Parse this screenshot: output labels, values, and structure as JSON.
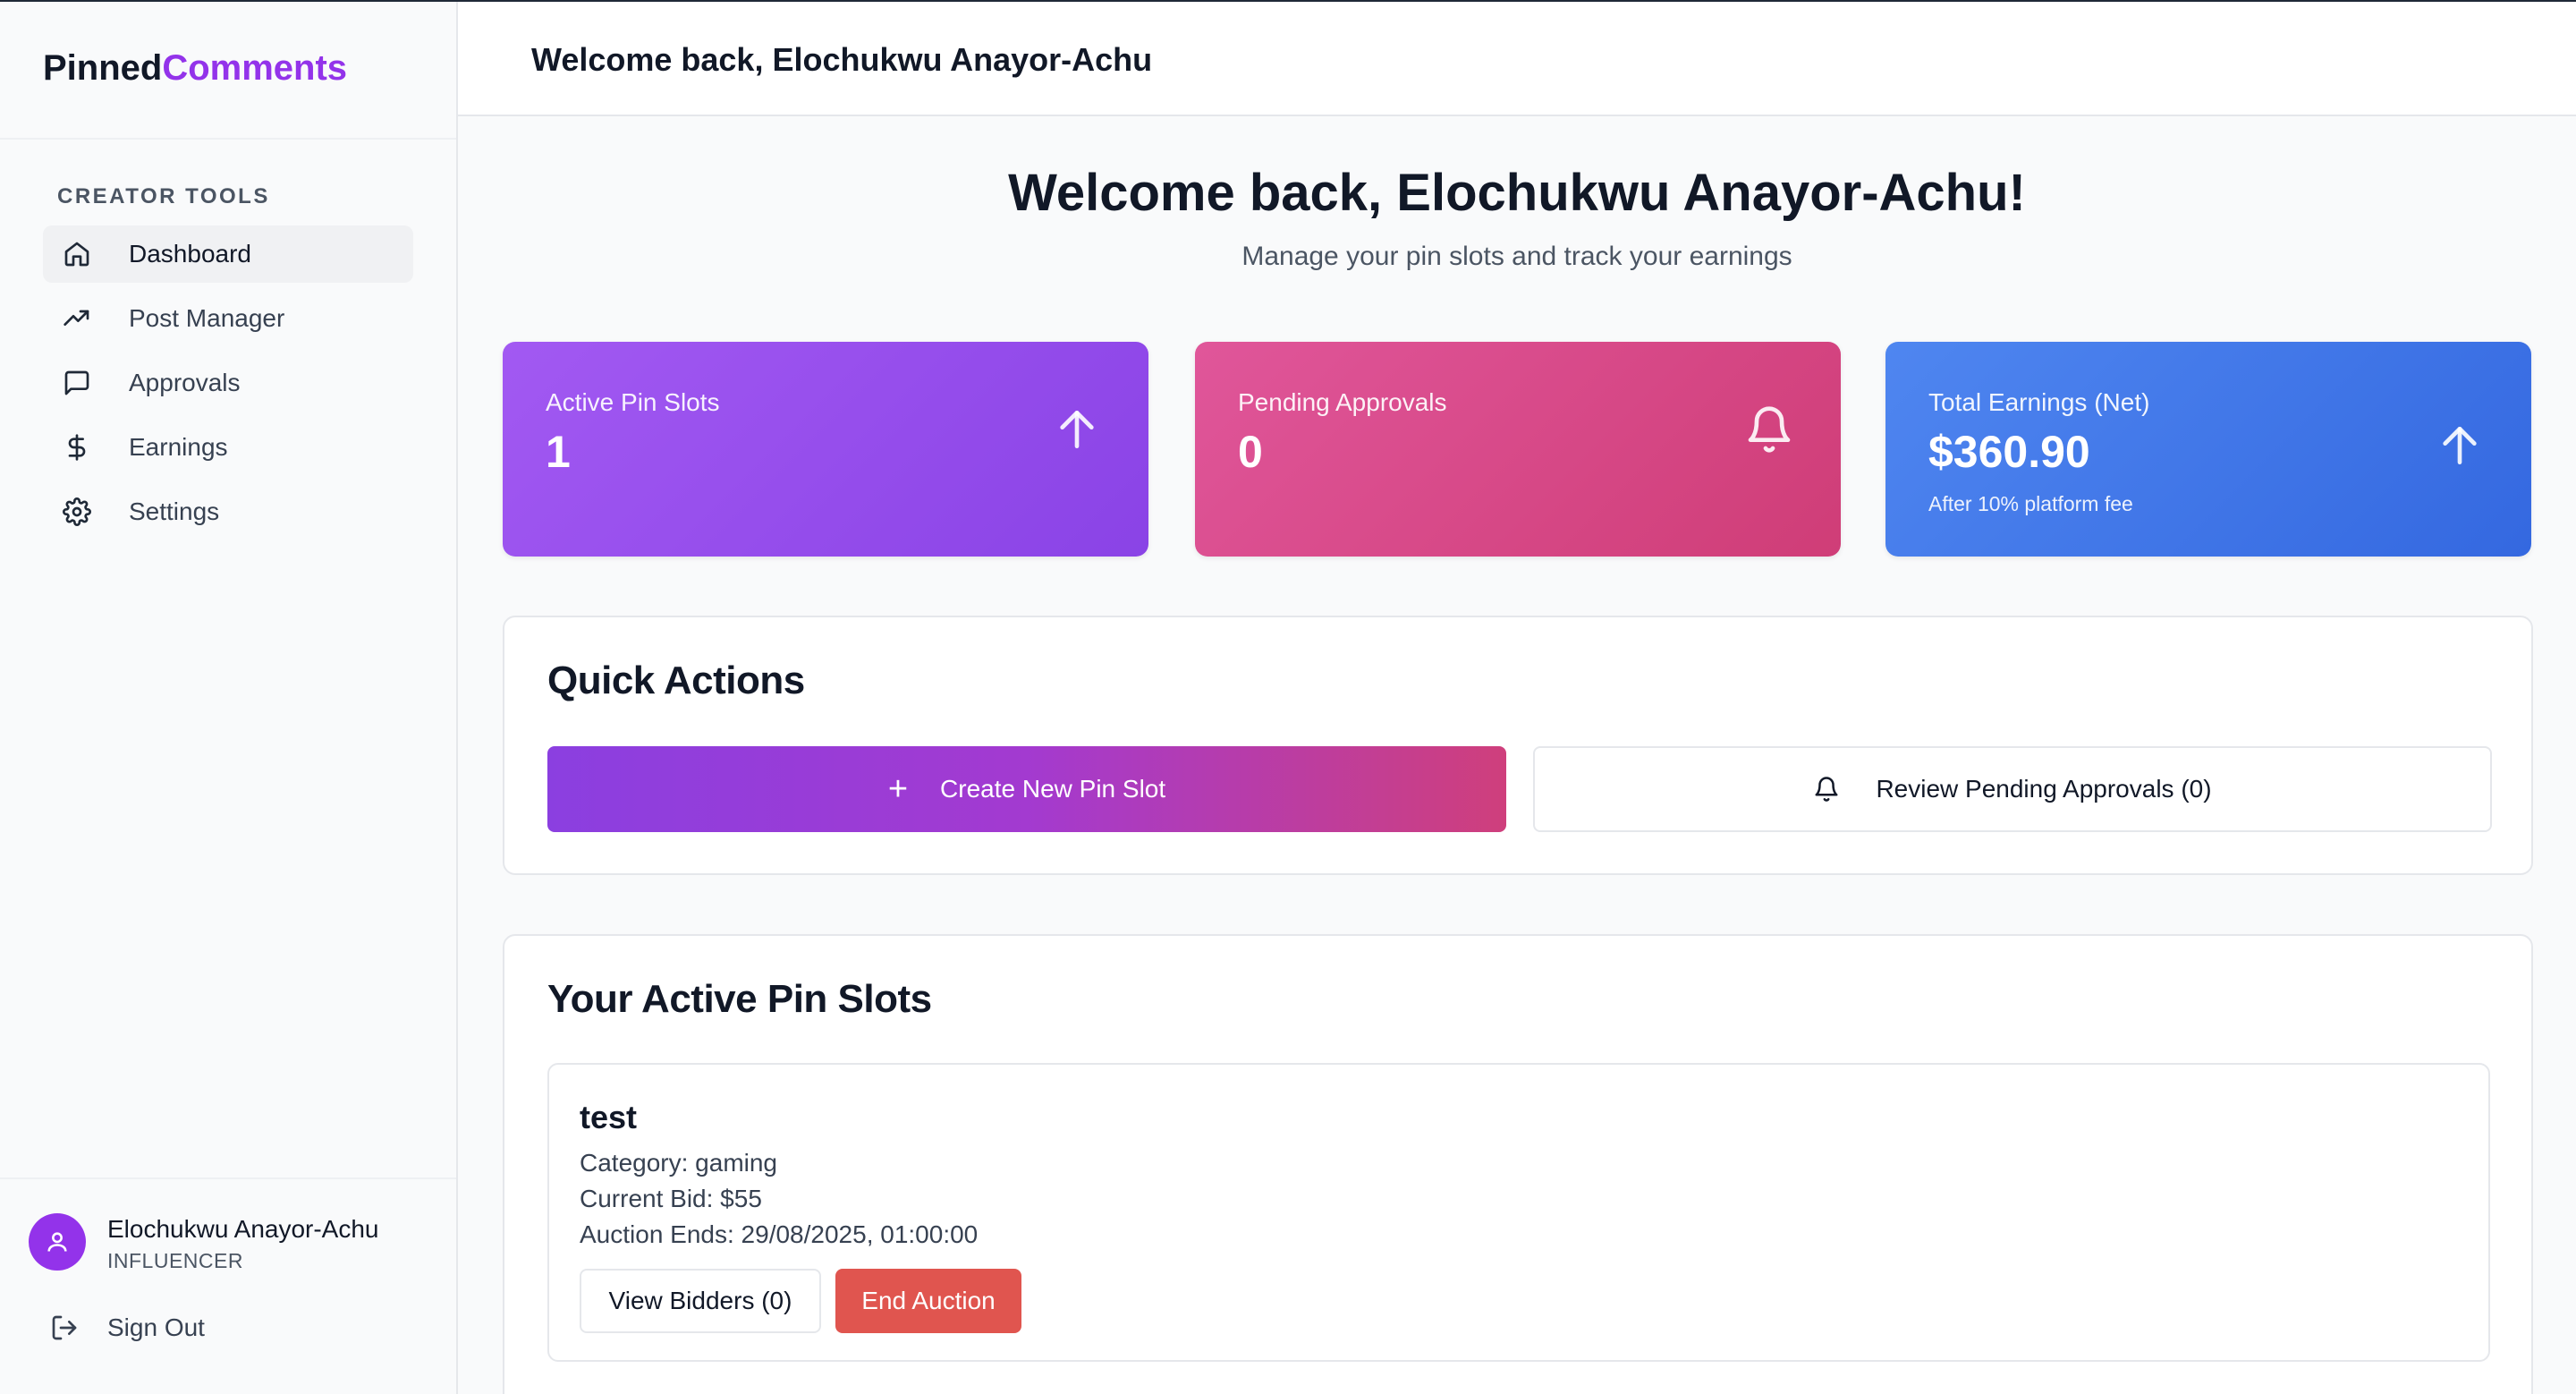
{
  "brand": {
    "part1": "Pinned",
    "part2": "Comments"
  },
  "sidebar": {
    "section_label": "CREATOR TOOLS",
    "items": [
      {
        "label": "Dashboard",
        "icon": "home-icon",
        "active": true
      },
      {
        "label": "Post Manager",
        "icon": "trending-up-icon"
      },
      {
        "label": "Approvals",
        "icon": "message-square-icon"
      },
      {
        "label": "Earnings",
        "icon": "dollar-icon"
      },
      {
        "label": "Settings",
        "icon": "gear-icon"
      }
    ],
    "user": {
      "name": "Elochukwu Anayor-Achu",
      "role": "INFLUENCER"
    },
    "signout_label": "Sign Out"
  },
  "header": {
    "title": "Welcome back, Elochukwu Anayor-Achu"
  },
  "hero": {
    "title": "Welcome back, Elochukwu Anayor-Achu!",
    "subtitle": "Manage your pin slots and track your earnings"
  },
  "stats": [
    {
      "label": "Active Pin Slots",
      "value": "1",
      "icon": "arrow-up-icon",
      "color": "#9b51ef"
    },
    {
      "label": "Pending Approvals",
      "value": "0",
      "icon": "bell-icon",
      "color": "#d84a88"
    },
    {
      "label": "Total Earnings (Net)",
      "value": "$360.90",
      "note": "After 10% platform fee",
      "icon": "arrow-up-icon",
      "color": "#4178e8"
    }
  ],
  "quick_actions": {
    "title": "Quick Actions",
    "create_label": "Create New Pin Slot",
    "review_label": "Review Pending Approvals (0)"
  },
  "active_slots": {
    "title": "Your Active Pin Slots",
    "items": [
      {
        "name": "test",
        "category": "Category: gaming",
        "current_bid": "Current Bid: $55",
        "auction_ends": "Auction Ends: 29/08/2025, 01:00:00",
        "view_bidders_label": "View Bidders (0)",
        "end_auction_label": "End Auction"
      }
    ]
  }
}
